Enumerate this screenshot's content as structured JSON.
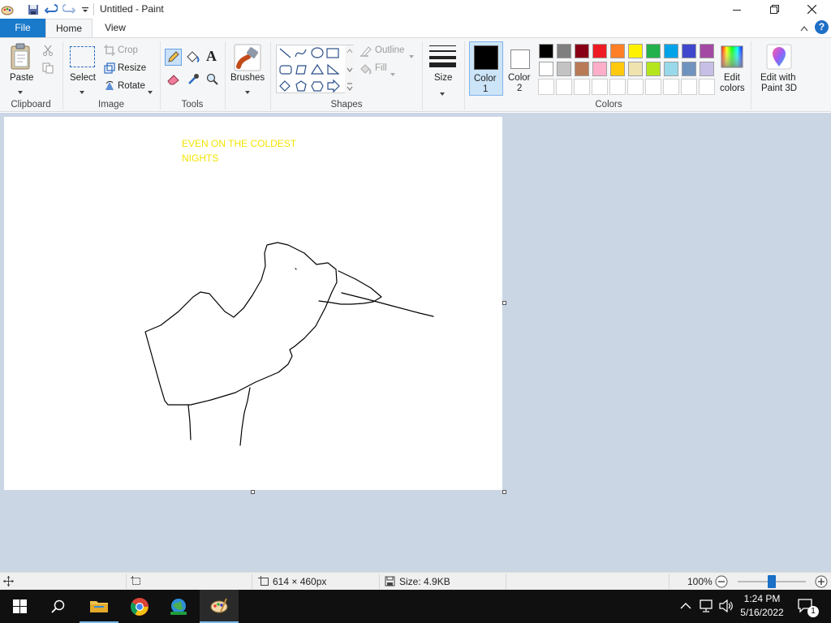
{
  "window": {
    "title": "Untitled - Paint"
  },
  "tabs": {
    "file": "File",
    "home": "Home",
    "view": "View"
  },
  "ribbon": {
    "clipboard": {
      "paste": "Paste",
      "group": "Clipboard"
    },
    "image": {
      "select": "Select",
      "crop": "Crop",
      "resize": "Resize",
      "rotate": "Rotate",
      "group": "Image"
    },
    "tools": {
      "group": "Tools"
    },
    "brushes": {
      "label": "Brushes"
    },
    "shapes": {
      "outline": "Outline",
      "fill": "Fill",
      "group": "Shapes"
    },
    "size": {
      "label": "Size"
    },
    "colors": {
      "color1": "Color",
      "color1_num": "1",
      "color2": "Color",
      "color2_num": "2",
      "edit_line1": "Edit",
      "edit_line2": "colors",
      "group": "Colors",
      "active_color": "#000000",
      "row1": [
        "#000000",
        "#7f7f7f",
        "#880015",
        "#ed1c24",
        "#ff7f27",
        "#fff200",
        "#22b14c",
        "#00a2e8",
        "#3f48cc",
        "#a349a4"
      ],
      "row2": [
        "#ffffff",
        "#c3c3c3",
        "#b97a57",
        "#ffaec9",
        "#ffc90e",
        "#efe4b0",
        "#b5e61d",
        "#99d9ea",
        "#7092be",
        "#c8bfe7"
      ]
    },
    "paint3d": {
      "line1": "Edit with",
      "line2": "Paint 3D"
    }
  },
  "canvas": {
    "text_line1": "EVEN ON THE COLDEST",
    "text_line2": "NIGHTS",
    "text_color": "#f3e400"
  },
  "statusbar": {
    "dimensions": "614 × 460px",
    "size": "Size: 4.9KB",
    "zoom": "100%",
    "zoom_level": 1.0
  },
  "taskbar": {
    "time": "1:24 PM",
    "date": "5/16/2022",
    "notification_count": "1"
  }
}
